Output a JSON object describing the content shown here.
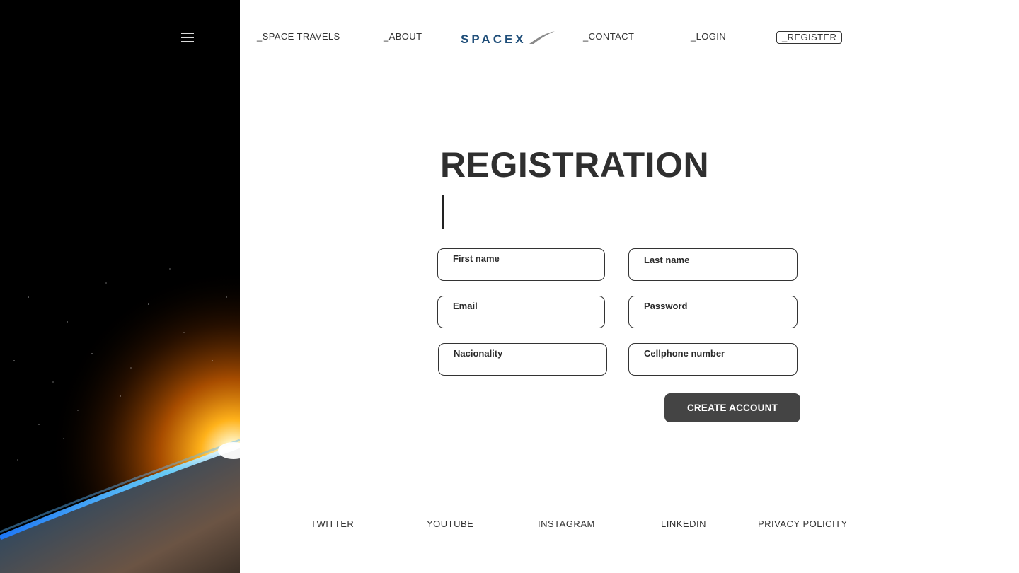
{
  "nav": {
    "space_travels": "_SPACE TRAVELS",
    "about": "_ABOUT",
    "contact": "_CONTACT",
    "login": "_LOGIN",
    "register": "_REGISTER"
  },
  "logo": {
    "text": "SPACEX",
    "color": "#1f4e79"
  },
  "page": {
    "title": "REGISTRATION"
  },
  "form": {
    "first_name": {
      "label": "First name",
      "value": ""
    },
    "last_name": {
      "label": "Last name",
      "value": ""
    },
    "email": {
      "label": "Email",
      "value": ""
    },
    "password": {
      "label": "Password",
      "value": ""
    },
    "nationality": {
      "label": "Nacionality",
      "value": ""
    },
    "cellphone": {
      "label": "Cellphone number",
      "value": ""
    },
    "submit_label": "CREATE ACCOUNT"
  },
  "footer": {
    "twitter": "TWITTER",
    "youtube": "YOUTUBE",
    "instagram": "INSTAGRAM",
    "linkedin": "LINKEDIN",
    "privacy": "PRIVACY POLICITY"
  },
  "icons": {
    "menu": "hamburger-menu-icon"
  }
}
